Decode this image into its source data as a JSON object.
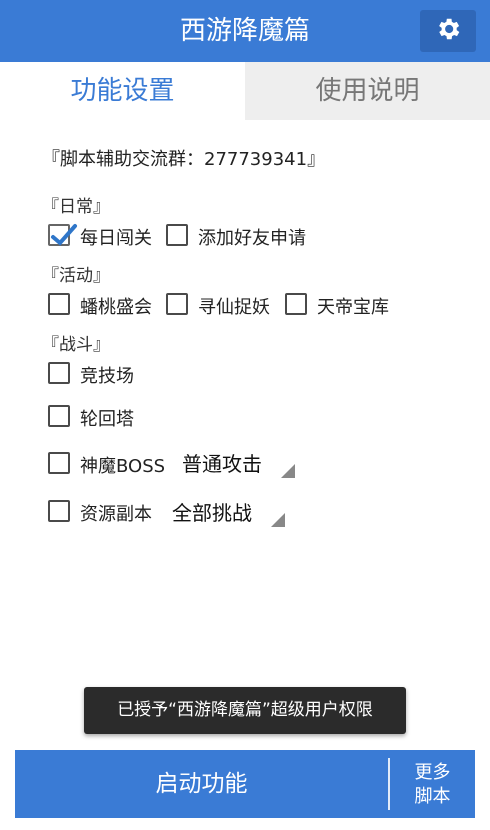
{
  "app": {
    "title": "西游降魔篇",
    "settings_icon": "gear-icon",
    "accent": "#3a7bd5"
  },
  "tabs": [
    {
      "label": "功能设置",
      "active": true
    },
    {
      "label": "使用说明",
      "active": false
    }
  ],
  "group_info": "『脚本辅助交流群：277739341』",
  "sections": {
    "daily": {
      "label": "『日常』",
      "items": [
        {
          "label": "每日闯关",
          "checked": true
        },
        {
          "label": "添加好友申请",
          "checked": false
        }
      ]
    },
    "events": {
      "label": "『活动』",
      "items": [
        {
          "label": "蟠桃盛会",
          "checked": false
        },
        {
          "label": "寻仙捉妖",
          "checked": false
        },
        {
          "label": "天帝宝库",
          "checked": false
        }
      ]
    },
    "battle": {
      "label": "『战斗』",
      "items": [
        {
          "label": "竞技场",
          "checked": false
        },
        {
          "label": "轮回塔",
          "checked": false
        },
        {
          "label": "神魔BOSS",
          "checked": false,
          "select": "普通攻击"
        },
        {
          "label": "资源副本",
          "checked": false,
          "select": "全部挑战"
        }
      ]
    }
  },
  "toast": "已授予“西游降魔篇”超级用户权限",
  "bottom": {
    "start_label": "启动功能",
    "more_line1": "更多",
    "more_line2": "脚本"
  }
}
